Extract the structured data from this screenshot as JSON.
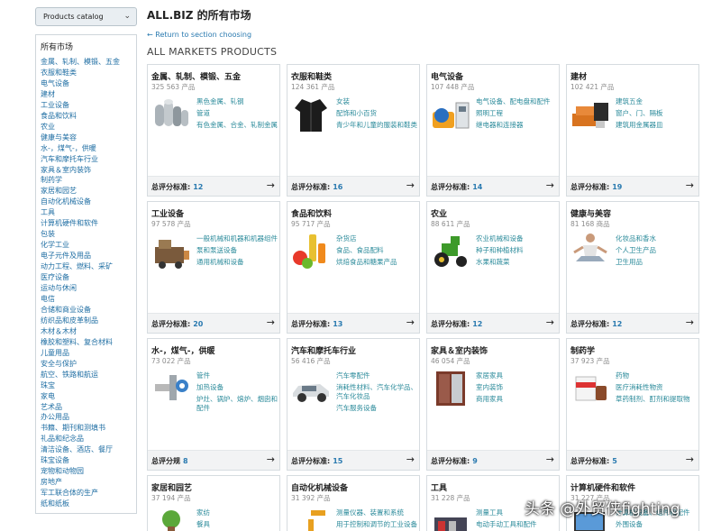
{
  "catalog_select": {
    "label": "Products catalog"
  },
  "sidebar": {
    "title": "所有市场",
    "items": [
      "金属、轧制、模锻、五金",
      "衣服和鞋类",
      "电气设备",
      "建材",
      "工业设备",
      "食品和饮料",
      "农业",
      "健康与美容",
      "水-，煤气-，供暖",
      "汽车和摩托车行业",
      "家具＆室内装饰",
      "制药学",
      "家居和园艺",
      "自动化机械设备",
      "工具",
      "计算机硬件和软件",
      "包装",
      "化学工业",
      "电子元件及用品",
      "动力工程、燃料、采矿",
      "医疗设备",
      "运动与休闲",
      "电信",
      "合储和商业设备",
      "纺织品和皮革制品",
      "木材＆木材",
      "橡胶和塑料、复合材料",
      "儿童用品",
      "安全与保护",
      "航空、铁路和航运",
      "珠宝",
      "家电",
      "艺术品",
      "办公用品",
      "书籍、期刊和测填书",
      "礼品和纪念品",
      "清洁设备、酒店、餐厅",
      "珠宝设备",
      "宠物和动物园",
      "房地产",
      "军工联合体的生产",
      "纸和纸板"
    ]
  },
  "header": {
    "title": "ALL.BIZ 的所有市场",
    "back_link": "← Return to section choosing",
    "section_heading": "ALL MARKETS PRODUCTS"
  },
  "cards": [
    {
      "title": "金属、轧制、模锻、五金",
      "count": "325 563 产品",
      "image": "metal-pipes-image",
      "links": [
        "黑色金属、轧钢",
        "管道",
        "有色金属、合金、轧制金属"
      ],
      "std_label": "总评分标准:",
      "std_value": "12"
    },
    {
      "title": "衣服和鞋类",
      "count": "124 361 产品",
      "image": "clothing-jacket-image",
      "links": [
        "女装",
        "配饰和小百货",
        "青少年和儿童的服装和鞋类"
      ],
      "std_label": "总评分标准:",
      "std_value": "16"
    },
    {
      "title": "电气设备",
      "count": "107 448 产品",
      "image": "electrical-equipment-image",
      "links": [
        "电气设备、配电盘和配件",
        "照明工程",
        "继电器和连接器"
      ],
      "std_label": "总评分标准:",
      "std_value": "14"
    },
    {
      "title": "建材",
      "count": "102 421 产品",
      "image": "building-materials-image",
      "links": [
        "建筑五金",
        "窗户、门、隔板",
        "建筑用金属器皿"
      ],
      "std_label": "总评分标准:",
      "std_value": "19"
    },
    {
      "title": "工业设备",
      "count": "97 578 产品",
      "image": "industrial-machine-image",
      "links": [
        "一般机械和机器和机器组件",
        "泵和泵送设备",
        "通用机械和设备"
      ],
      "std_label": "总评分标准:",
      "std_value": "20"
    },
    {
      "title": "食品和饮料",
      "count": "95 717 产品",
      "image": "food-drinks-image",
      "links": [
        "杂货店",
        "食品、食品配料",
        "烘焙食品和糖果产品"
      ],
      "std_label": "总评分标准:",
      "std_value": "13"
    },
    {
      "title": "农业",
      "count": "88 611 产品",
      "image": "tractor-image",
      "links": [
        "农业机械和设备",
        "种子和种植材料",
        "水果和蔬菜"
      ],
      "std_label": "总评分标准:",
      "std_value": "12"
    },
    {
      "title": "健康与美容",
      "count": "81 168 商品",
      "image": "yoga-woman-image",
      "links": [
        "化妆品和香水",
        "个人卫生产品",
        "卫生用品"
      ],
      "std_label": "总评分标准:",
      "std_value": "12"
    },
    {
      "title": "水-，煤气-，供暖",
      "count": "73 022 产品",
      "image": "pipe-fittings-image",
      "links": [
        "管件",
        "加热设备",
        "炉灶、锅炉、熔炉、烟囱和配件"
      ],
      "std_label": "总评分规",
      "std_value": "8"
    },
    {
      "title": "汽车和摩托车行业",
      "count": "56 416 产品",
      "image": "car-image",
      "links": [
        "汽车零配件",
        "消耗性材料、汽车化学品、汽车化妆品",
        "汽车服务设备"
      ],
      "std_label": "总评分标准:",
      "std_value": "15"
    },
    {
      "title": "家具＆室内装饰",
      "count": "46 054 产品",
      "image": "wardrobe-image",
      "links": [
        "家居家具",
        "室内装饰",
        "商用家具"
      ],
      "std_label": "总评分标准:",
      "std_value": "9"
    },
    {
      "title": "制药学",
      "count": "37 923 产品",
      "image": "pharmacy-image",
      "links": [
        "药物",
        "医疗消耗性物资",
        "草药制剂、酊剂和提取物"
      ],
      "std_label": "总评分标准:",
      "std_value": "5"
    },
    {
      "title": "家居和园艺",
      "count": "37 194 产品",
      "image": "home-garden-image",
      "links": [
        "家纺",
        "餐具"
      ],
      "std_label": "",
      "std_value": ""
    },
    {
      "title": "自动化机械设备",
      "count": "31 392 产品",
      "image": "robot-arm-image",
      "links": [
        "测量仪器、装置和系统",
        "用于控制和调节的工业设备"
      ],
      "std_label": "",
      "std_value": ""
    },
    {
      "title": "工具",
      "count": "31 228 产品",
      "image": "tools-image",
      "links": [
        "测量工具",
        "电动手动工具和配件"
      ],
      "std_label": "",
      "std_value": ""
    },
    {
      "title": "计算机硬件和软件",
      "count": "31 227 产品",
      "image": "computer-image",
      "links": [
        "计算机设备、组件和配件",
        "外围设备"
      ],
      "std_label": "",
      "std_value": ""
    }
  ],
  "watermark": "头条 @外贸侠fighting"
}
